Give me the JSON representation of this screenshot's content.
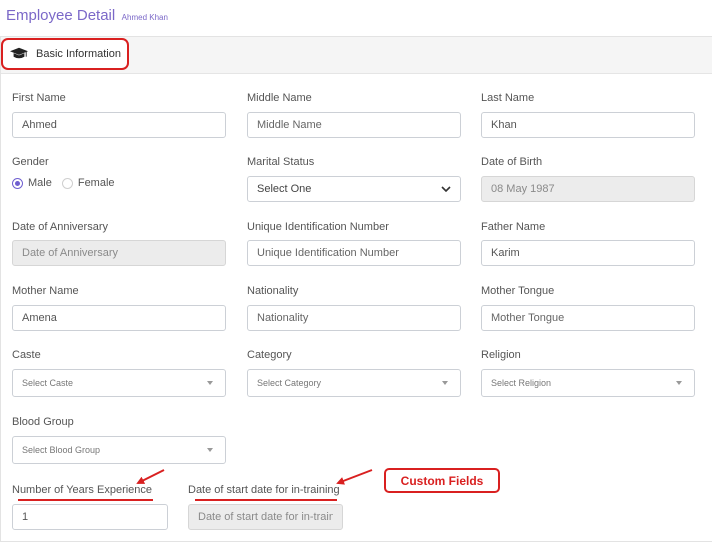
{
  "header": {
    "title": "Employee Detail",
    "subtitle": "Ahmed Khan"
  },
  "tab": {
    "label": "Basic Information",
    "icon": "graduation-cap-icon"
  },
  "fields": {
    "first_name": {
      "label": "First Name",
      "value": "Ahmed"
    },
    "middle_name": {
      "label": "Middle Name",
      "placeholder": "Middle Name"
    },
    "last_name": {
      "label": "Last Name",
      "value": "Khan"
    },
    "gender": {
      "label": "Gender",
      "options": [
        "Male",
        "Female"
      ],
      "selected": "Male"
    },
    "marital_status": {
      "label": "Marital Status",
      "selected": "Select One"
    },
    "date_of_birth": {
      "label": "Date of Birth",
      "placeholder": "08 May 1987"
    },
    "date_of_anniversary": {
      "label": "Date of Anniversary",
      "placeholder": "Date of Anniversary"
    },
    "unique_id": {
      "label": "Unique Identification Number",
      "placeholder": "Unique Identification Number"
    },
    "father_name": {
      "label": "Father Name",
      "value": "Karim"
    },
    "mother_name": {
      "label": "Mother Name",
      "value": "Amena"
    },
    "nationality": {
      "label": "Nationality",
      "placeholder": "Nationality"
    },
    "mother_tongue": {
      "label": "Mother Tongue",
      "placeholder": "Mother Tongue"
    },
    "caste": {
      "label": "Caste",
      "selected": "Select Caste"
    },
    "category": {
      "label": "Category",
      "selected": "Select Category"
    },
    "religion": {
      "label": "Religion",
      "selected": "Select Religion"
    },
    "blood_group": {
      "label": "Blood Group",
      "selected": "Select Blood Group"
    },
    "years_experience": {
      "label": "Number of Years Experience",
      "value": "1"
    },
    "training_start": {
      "label": "Date of start date for in-training",
      "placeholder": "Date of start date for in-traini"
    }
  },
  "annotation": {
    "label": "Custom Fields"
  },
  "colors": {
    "accent": "#7b68c8",
    "annotation": "#d92020",
    "readonly_bg": "#ececec"
  }
}
